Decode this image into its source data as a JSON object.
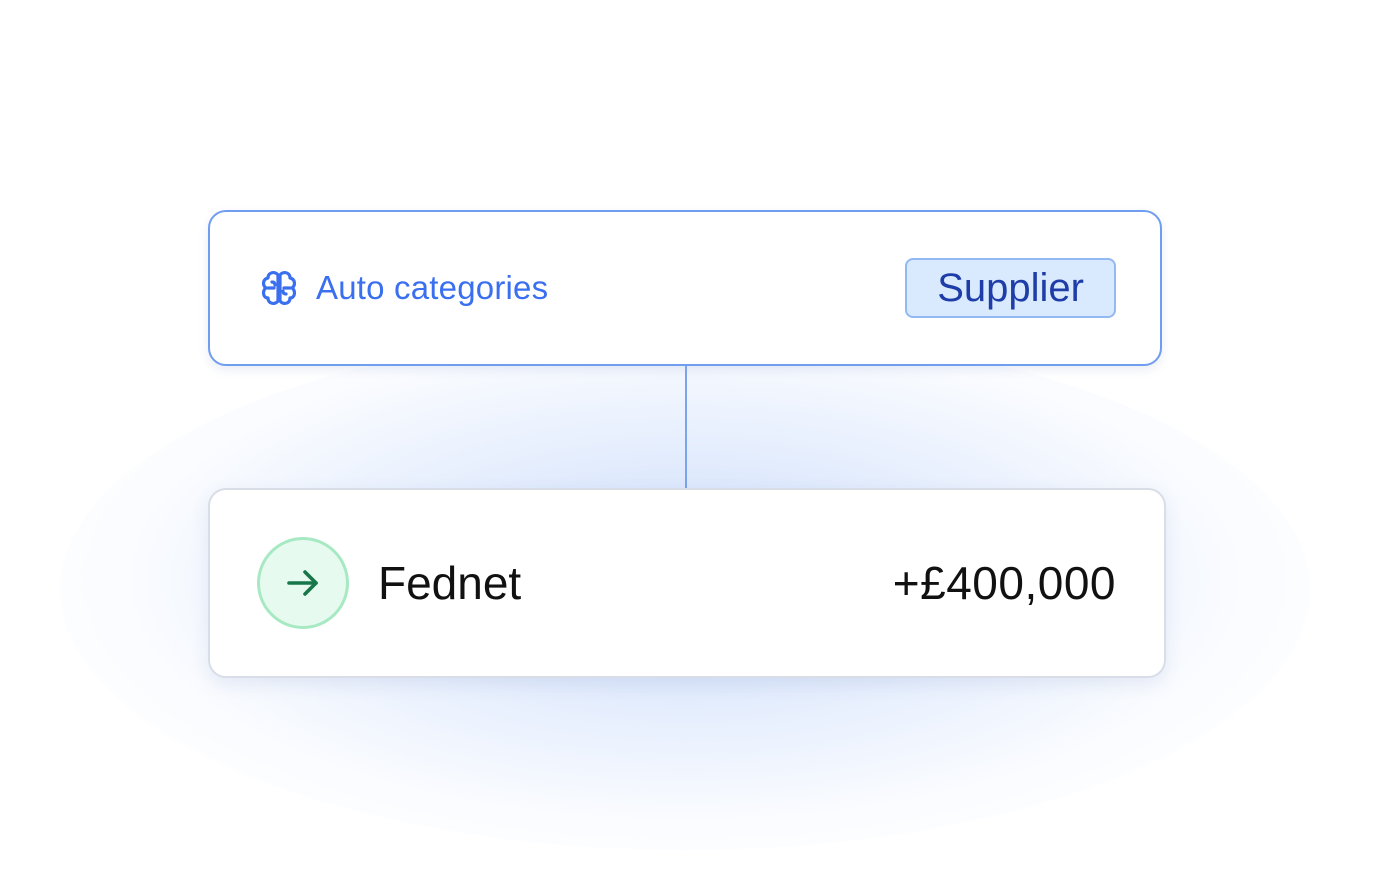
{
  "category_card": {
    "icon": "brain-icon",
    "label": "Auto categories",
    "badge": "Supplier"
  },
  "transaction": {
    "icon": "arrow-right-icon",
    "merchant": "Fednet",
    "amount": "+£400,000"
  },
  "colors": {
    "accent_blue": "#3a6ff0",
    "card_border_blue": "#6f9ef0",
    "badge_bg": "#d9e9fe",
    "badge_text": "#1f3da8",
    "incoming_green": "#17774a",
    "incoming_circle_bg": "#e7faef"
  }
}
